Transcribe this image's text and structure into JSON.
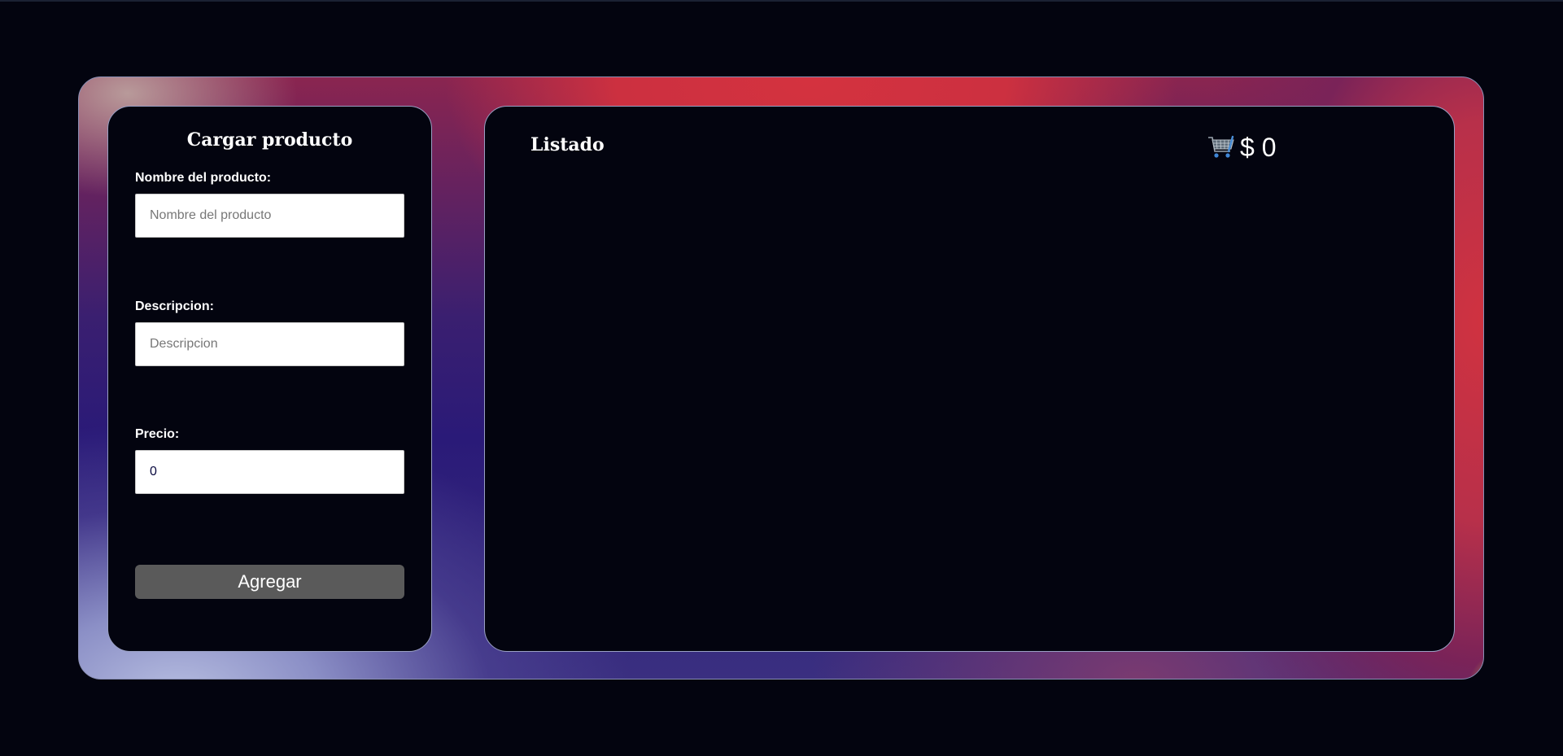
{
  "form": {
    "title": "Cargar producto",
    "name_label": "Nombre del producto:",
    "name_placeholder": "Nombre del producto",
    "name_value": "",
    "description_label": "Descripcion:",
    "description_placeholder": "Descripcion",
    "description_value": "",
    "price_label": "Precio:",
    "price_value": "0",
    "add_label": "Agregar"
  },
  "list": {
    "title": "Listado",
    "cart_icon": "shopping-cart-icon",
    "total_text": "$ 0",
    "items": []
  },
  "colors": {
    "background": "#03040f",
    "button": "#5a5a5a",
    "accent_red": "#cc3040",
    "accent_purple": "#2a1a78"
  }
}
